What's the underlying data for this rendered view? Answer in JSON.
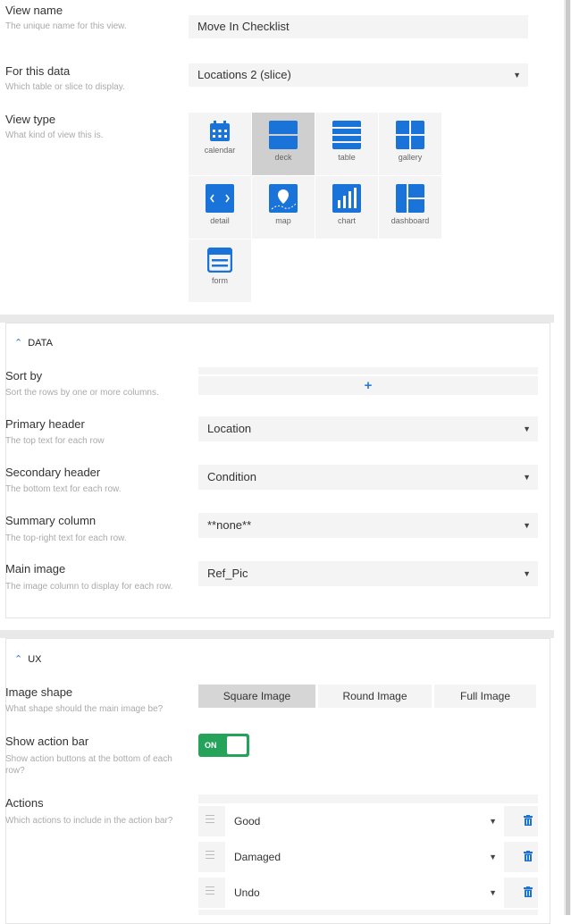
{
  "view_name": {
    "label": "View name",
    "hint": "The unique name for this view.",
    "value": "Move In Checklist"
  },
  "for_this_data": {
    "label": "For this data",
    "hint": "Which table or slice to display.",
    "value": "Locations 2 (slice)"
  },
  "view_type": {
    "label": "View type",
    "hint": "What kind of view this is.",
    "options": [
      "calendar",
      "deck",
      "table",
      "gallery",
      "detail",
      "map",
      "chart",
      "dashboard",
      "form"
    ],
    "selected": "deck"
  },
  "data_section": {
    "title": "DATA",
    "sort_by": {
      "label": "Sort by",
      "hint": "Sort the rows by one or more columns.",
      "add": "+"
    },
    "primary_header": {
      "label": "Primary header",
      "hint": "The top text for each row",
      "value": "Location"
    },
    "secondary_header": {
      "label": "Secondary header",
      "hint": "The bottom text for each row.",
      "value": "Condition"
    },
    "summary_column": {
      "label": "Summary column",
      "hint": "The top-right text for each row.",
      "value": "**none**"
    },
    "main_image": {
      "label": "Main image",
      "hint": "The image column to display for each row.",
      "value": "Ref_Pic"
    }
  },
  "ux_section": {
    "title": "UX",
    "image_shape": {
      "label": "Image shape",
      "hint": "What shape should the main image be?",
      "options": [
        "Square Image",
        "Round Image",
        "Full Image"
      ],
      "selected": "Square Image"
    },
    "show_action_bar": {
      "label": "Show action bar",
      "hint": "Show action buttons at the bottom of each row?",
      "state": "ON"
    },
    "actions": {
      "label": "Actions",
      "hint": "Which actions to include in the action bar?",
      "items": [
        "Good",
        "Damaged",
        "Undo"
      ]
    }
  },
  "colors": {
    "accent": "#2b7bd1",
    "toggle_on": "#25a35a",
    "icon": "#1a73d9"
  }
}
